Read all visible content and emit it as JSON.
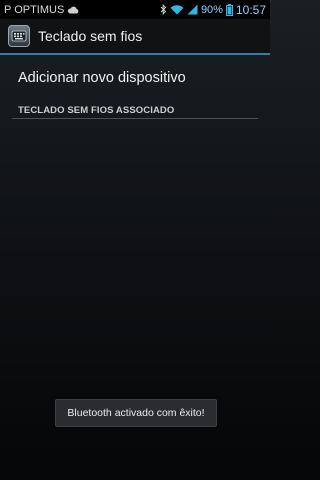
{
  "status_bar": {
    "carrier": "P OPTIMUS",
    "battery_percent": "90%",
    "time": "10:57",
    "icons": [
      "cloud-icon",
      "bluetooth-icon",
      "wifi-icon",
      "signal-icon",
      "battery-icon"
    ]
  },
  "action_bar": {
    "title": "Teclado sem fios",
    "icon": "keyboard-icon"
  },
  "content": {
    "add_device_label": "Adicionar novo dispositivo",
    "paired_section_header": "TECLADO SEM FIOS ASSOCIADO"
  },
  "toast": {
    "message": "Bluetooth activado com êxito!"
  },
  "colors": {
    "accent": "#2f7fae",
    "status_highlight": "#8fd3ff"
  }
}
